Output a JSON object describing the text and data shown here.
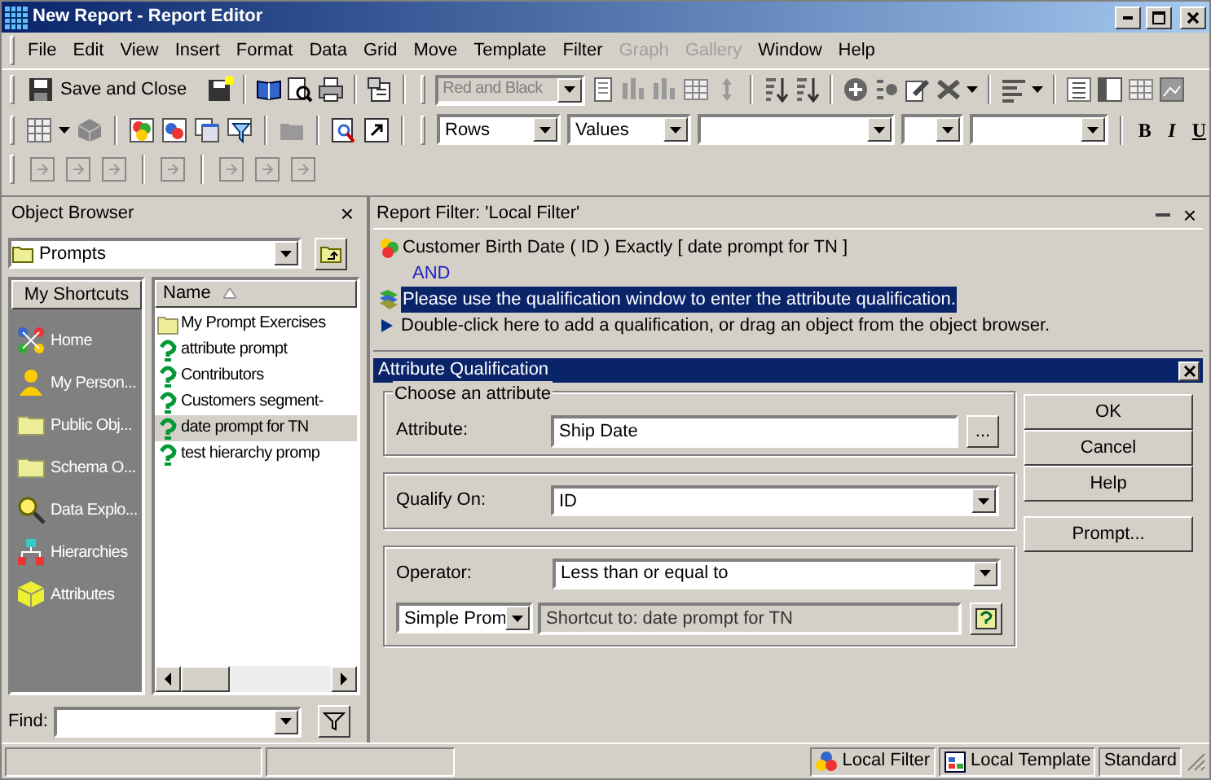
{
  "window": {
    "title": "New Report - Report Editor"
  },
  "menu": [
    {
      "label": "File",
      "disabled": false
    },
    {
      "label": "Edit",
      "disabled": false
    },
    {
      "label": "View",
      "disabled": false
    },
    {
      "label": "Insert",
      "disabled": false
    },
    {
      "label": "Format",
      "disabled": false
    },
    {
      "label": "Data",
      "disabled": false
    },
    {
      "label": "Grid",
      "disabled": false
    },
    {
      "label": "Move",
      "disabled": false
    },
    {
      "label": "Template",
      "disabled": false
    },
    {
      "label": "Filter",
      "disabled": false
    },
    {
      "label": "Graph",
      "disabled": true
    },
    {
      "label": "Gallery",
      "disabled": true
    },
    {
      "label": "Window",
      "disabled": false
    },
    {
      "label": "Help",
      "disabled": false
    }
  ],
  "toolbar": {
    "save_close": "Save and Close",
    "color_scheme": {
      "value": "Red and Black",
      "disabled": true
    },
    "rows": "Rows",
    "values": "Values",
    "bold": "B",
    "italic": "I",
    "underline": "U"
  },
  "object_browser": {
    "title": "Object Browser",
    "close": "×",
    "location": "Prompts",
    "shortcuts_title": "My Shortcuts",
    "shortcuts": [
      {
        "label": "Home",
        "kind": "network"
      },
      {
        "label": "My Person...",
        "kind": "person"
      },
      {
        "label": "Public Obj...",
        "kind": "folder"
      },
      {
        "label": "Schema O...",
        "kind": "folder"
      },
      {
        "label": "Data Explo...",
        "kind": "explorer"
      },
      {
        "label": "Hierarchies",
        "kind": "hierarchy"
      },
      {
        "label": "Attributes",
        "kind": "cube"
      }
    ],
    "column": "Name",
    "items": [
      {
        "label": "My Prompt Exercises",
        "kind": "folder",
        "selected": false
      },
      {
        "label": "attribute prompt",
        "kind": "prompt",
        "selected": false
      },
      {
        "label": "Contributors",
        "kind": "prompt",
        "selected": false
      },
      {
        "label": "Customers segment-",
        "kind": "prompt",
        "selected": false
      },
      {
        "label": "date prompt for TN",
        "kind": "prompt",
        "selected": true
      },
      {
        "label": "test hierarchy promp",
        "kind": "prompt",
        "selected": false
      }
    ],
    "find_label": "Find:"
  },
  "report_filter": {
    "title": "Report Filter: 'Local Filter'",
    "close": "×",
    "lines": [
      {
        "kind": "condition",
        "text": "Customer Birth Date ( ID )  Exactly [ date prompt for TN ]",
        "selected": false
      },
      {
        "kind": "operator",
        "text": "AND",
        "selected": false
      },
      {
        "kind": "pending",
        "text": "Please use the qualification window to enter the attribute qualification.",
        "selected": true
      },
      {
        "kind": "hint",
        "text": "Double-click here to add a qualification, or drag an object from the object browser.",
        "selected": false
      }
    ]
  },
  "attribute_qualification": {
    "title": "Attribute Qualification",
    "group_label": "Choose an attribute",
    "attribute": {
      "label": "Attribute:",
      "value": "Ship Date",
      "browse": "..."
    },
    "qualify_on": {
      "label": "Qualify On:",
      "value": "ID"
    },
    "operator": {
      "label": "Operator:",
      "value": "Less than or equal to"
    },
    "prompt_type": "Simple Prom",
    "prompt_value": "Shortcut to: date prompt for TN",
    "buttons": [
      "OK",
      "Cancel",
      "Help",
      "Prompt..."
    ]
  },
  "status_bar": [
    {
      "kind": "filter",
      "label": "Local Filter"
    },
    {
      "kind": "template",
      "label": "Local Template"
    },
    {
      "kind": "plain",
      "label": "Standard"
    }
  ]
}
